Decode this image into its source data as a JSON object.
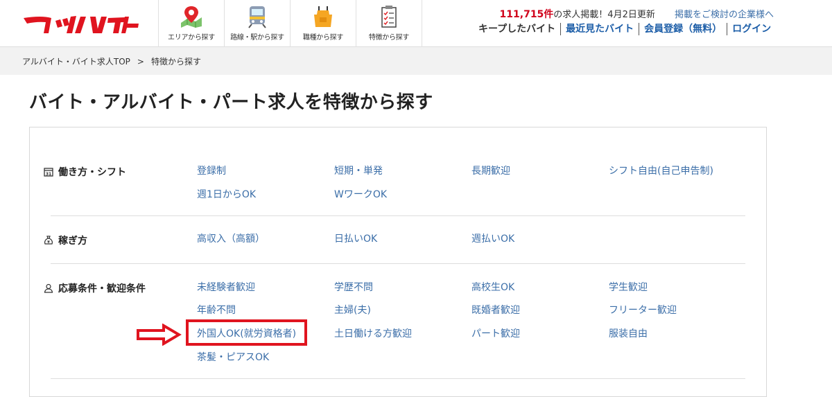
{
  "header": {
    "logo_text": "マッハバイト",
    "nav": [
      {
        "label": "エリアから探す",
        "icon": "map-pin-icon"
      },
      {
        "label": "路線・駅から探す",
        "icon": "train-icon"
      },
      {
        "label": "職種から探す",
        "icon": "apron-icon"
      },
      {
        "label": "特徴から探す",
        "icon": "checklist-icon"
      }
    ],
    "job_count": "111,715件",
    "job_count_suffix": "の求人掲載！4月2日更新",
    "company_link": "掲載をご検討の企業様へ",
    "links": [
      "キープしたバイト",
      "最近見たバイト",
      "会員登録（無料）",
      "ログイン"
    ]
  },
  "breadcrumb": {
    "home": "アルバイト・バイト求人TOP",
    "separator": ">",
    "current": "特徴から探す"
  },
  "page_title": "バイト・アルバイト・パート求人を特徴から探す",
  "sections": [
    {
      "title": "働き方・シフト",
      "icon": "calendar-icon",
      "items": [
        "登録制",
        "短期・単発",
        "長期歓迎",
        "シフト自由(自己申告制)",
        "週1日からOK",
        "WワークOK"
      ]
    },
    {
      "title": "稼ぎ方",
      "icon": "money-bag-icon",
      "items": [
        "高収入（高額）",
        "日払いOK",
        "週払いOK"
      ]
    },
    {
      "title": "応募条件・歓迎条件",
      "icon": "person-icon",
      "items": [
        "未経験者歓迎",
        "学歴不問",
        "高校生OK",
        "学生歓迎",
        "年齢不問",
        "主婦(夫)",
        "既婚者歓迎",
        "フリーター歓迎",
        "外国人OK(就労資格者)",
        "土日働ける方歓迎",
        "パート歓迎",
        "服装自由",
        "茶髪・ピアスOK"
      ]
    }
  ],
  "colors": {
    "brand_red": "#e0141f",
    "link_blue": "#3b6ea8",
    "count_red": "#d0021b"
  }
}
